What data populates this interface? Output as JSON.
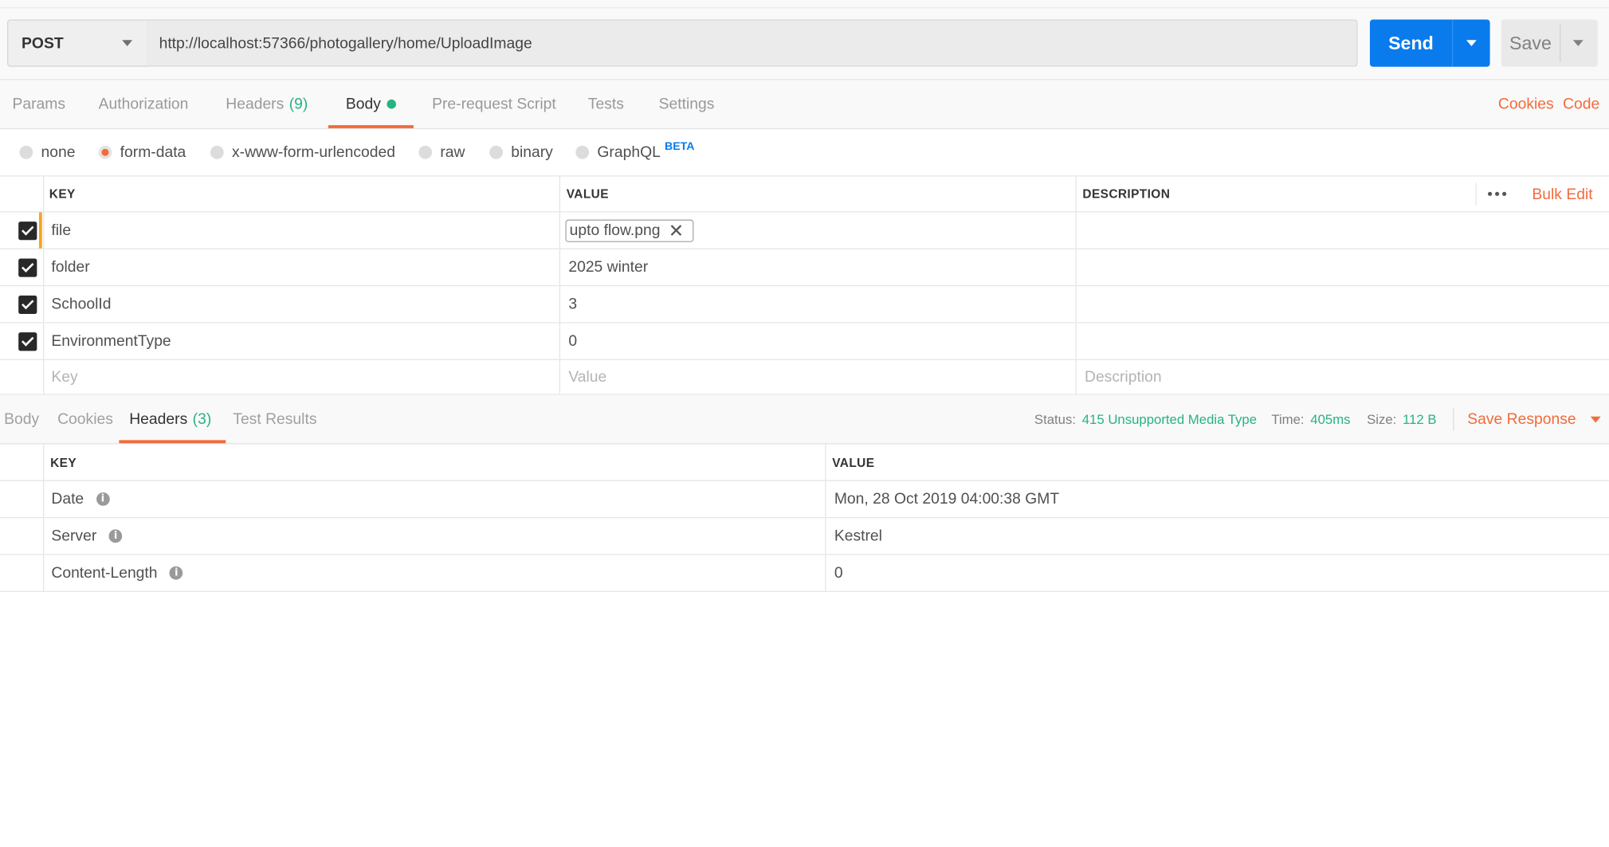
{
  "request": {
    "method": "POST",
    "url": "http://localhost:57366/photogallery/home/UploadImage",
    "send_label": "Send",
    "save_label": "Save"
  },
  "request_tabs": {
    "params": "Params",
    "authorization": "Authorization",
    "headers": "Headers",
    "headers_count": "(9)",
    "body": "Body",
    "pre_request": "Pre-request Script",
    "tests": "Tests",
    "settings": "Settings",
    "cookies": "Cookies",
    "code": "Code",
    "active": "Body"
  },
  "body_types": {
    "options": [
      "none",
      "form-data",
      "x-www-form-urlencoded",
      "raw",
      "binary",
      "GraphQL"
    ],
    "selected": "form-data",
    "graphql_badge": "BETA"
  },
  "form_table": {
    "headers": {
      "key": "KEY",
      "value": "VALUE",
      "description": "DESCRIPTION"
    },
    "bulk_edit": "Bulk Edit",
    "rows": [
      {
        "checked": true,
        "key": "file",
        "value": "upto flow.png",
        "is_file": true,
        "description": ""
      },
      {
        "checked": true,
        "key": "folder",
        "value": "2025 winter",
        "description": ""
      },
      {
        "checked": true,
        "key": "SchoolId",
        "value": "3",
        "description": ""
      },
      {
        "checked": true,
        "key": "EnvironmentType",
        "value": "0",
        "description": ""
      }
    ],
    "placeholders": {
      "key": "Key",
      "value": "Value",
      "description": "Description"
    }
  },
  "response": {
    "tabs": {
      "body": "Body",
      "cookies": "Cookies",
      "headers": "Headers",
      "headers_count": "(3)",
      "test_results": "Test Results"
    },
    "active_tab": "Headers",
    "status_label": "Status:",
    "status_value": "415 Unsupported Media Type",
    "time_label": "Time:",
    "time_value": "405ms",
    "size_label": "Size:",
    "size_value": "112 B",
    "save_response": "Save Response",
    "table_headers": {
      "key": "KEY",
      "value": "VALUE"
    },
    "headers": [
      {
        "key": "Date",
        "value": "Mon, 28 Oct 2019 04:00:38 GMT"
      },
      {
        "key": "Server",
        "value": "Kestrel"
      },
      {
        "key": "Content-Length",
        "value": "0"
      }
    ]
  },
  "colors": {
    "accent": "#f26b3a",
    "send_blue": "#097bed",
    "success_green": "#26b47f"
  }
}
